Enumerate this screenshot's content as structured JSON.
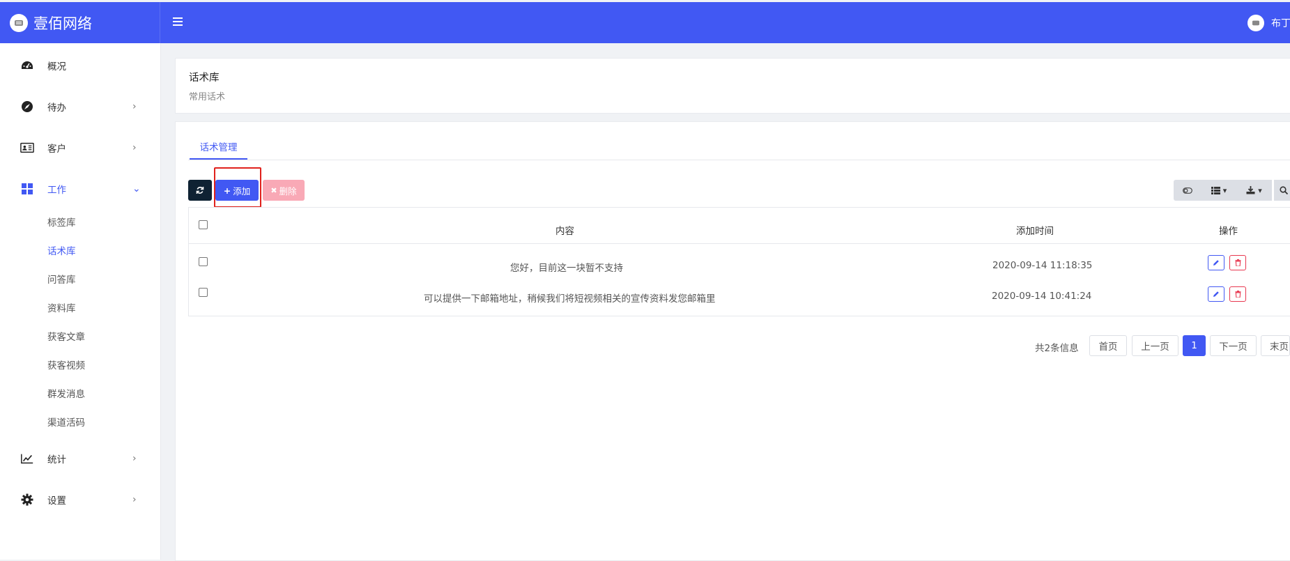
{
  "app": {
    "name": "壹佰网络"
  },
  "user": {
    "name": "布丁"
  },
  "sidebar": {
    "items": [
      {
        "label": "概况",
        "icon": "dashboard-icon"
      },
      {
        "label": "待办",
        "icon": "compass-icon"
      },
      {
        "label": "客户",
        "icon": "id-card-icon"
      },
      {
        "label": "工作",
        "icon": "grid-icon"
      },
      {
        "label": "统计",
        "icon": "line-chart-icon"
      },
      {
        "label": "设置",
        "icon": "gear-icon"
      }
    ],
    "work_subitems": [
      "标签库",
      "话术库",
      "问答库",
      "资料库",
      "获客文章",
      "获客视频",
      "群发消息",
      "渠道活码"
    ]
  },
  "page": {
    "title": "话术库",
    "subtitle": "常用话术"
  },
  "tabs": [
    {
      "label": "话术管理"
    }
  ],
  "toolbar": {
    "add_label": "添加",
    "delete_label": "删除"
  },
  "table": {
    "columns": [
      "内容",
      "添加时间",
      "操作"
    ],
    "rows": [
      {
        "content": "您好，目前这一块暂不支持",
        "added": "2020-09-14 11:18:35"
      },
      {
        "content": "可以提供一下邮箱地址，稍候我们将短视频相关的宣传资料发您邮箱里",
        "added": "2020-09-14 10:41:24"
      }
    ]
  },
  "pagination": {
    "info": "共2条信息",
    "first": "首页",
    "prev": "上一页",
    "current": "1",
    "next": "下一页",
    "last": "末页"
  },
  "colors": {
    "primary": "#4158f3",
    "danger": "#e8374f",
    "highlight": "#e0211c"
  }
}
